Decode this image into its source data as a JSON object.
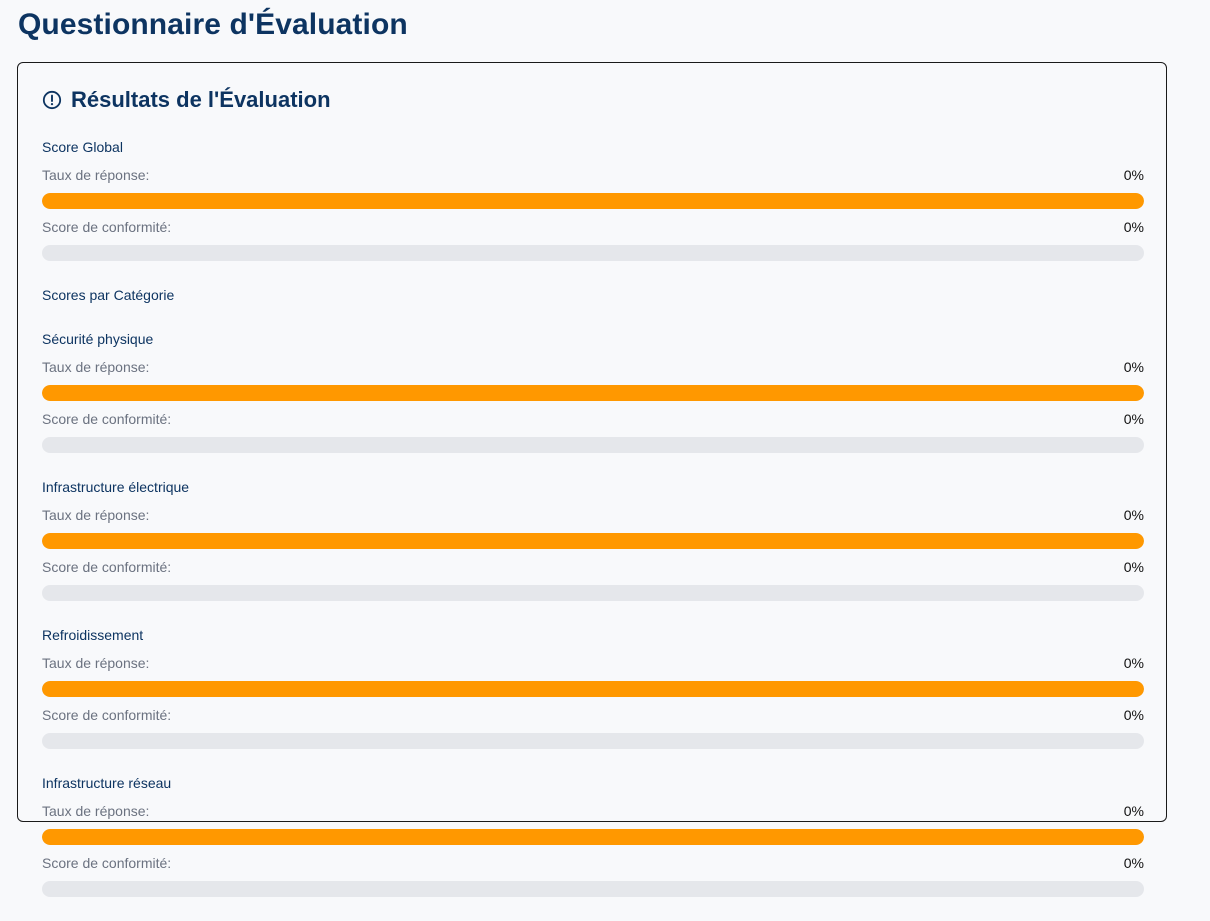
{
  "page": {
    "title": "Questionnaire d'Évaluation"
  },
  "results": {
    "title": "Résultats de l'Évaluation",
    "icon": "alert-circle-icon",
    "colors": {
      "response_bar": "#ff9800",
      "track": "#e5e7eb",
      "heading": "#0d3461"
    },
    "global": {
      "label": "Score Global",
      "response": {
        "label": "Taux de réponse:",
        "value": "0%",
        "fill_percent": 100
      },
      "compliance": {
        "label": "Score de conformité:",
        "value": "0%",
        "fill_percent": 0
      }
    },
    "categories_heading": "Scores par Catégorie",
    "categories": [
      {
        "name": "Sécurité physique",
        "response": {
          "label": "Taux de réponse:",
          "value": "0%",
          "fill_percent": 100
        },
        "compliance": {
          "label": "Score de conformité:",
          "value": "0%",
          "fill_percent": 0
        }
      },
      {
        "name": "Infrastructure électrique",
        "response": {
          "label": "Taux de réponse:",
          "value": "0%",
          "fill_percent": 100
        },
        "compliance": {
          "label": "Score de conformité:",
          "value": "0%",
          "fill_percent": 0
        }
      },
      {
        "name": "Refroidissement",
        "response": {
          "label": "Taux de réponse:",
          "value": "0%",
          "fill_percent": 100
        },
        "compliance": {
          "label": "Score de conformité:",
          "value": "0%",
          "fill_percent": 0
        }
      },
      {
        "name": "Infrastructure réseau",
        "response": {
          "label": "Taux de réponse:",
          "value": "0%",
          "fill_percent": 100
        },
        "compliance": {
          "label": "Score de conformité:",
          "value": "0%",
          "fill_percent": 0
        }
      }
    ]
  }
}
